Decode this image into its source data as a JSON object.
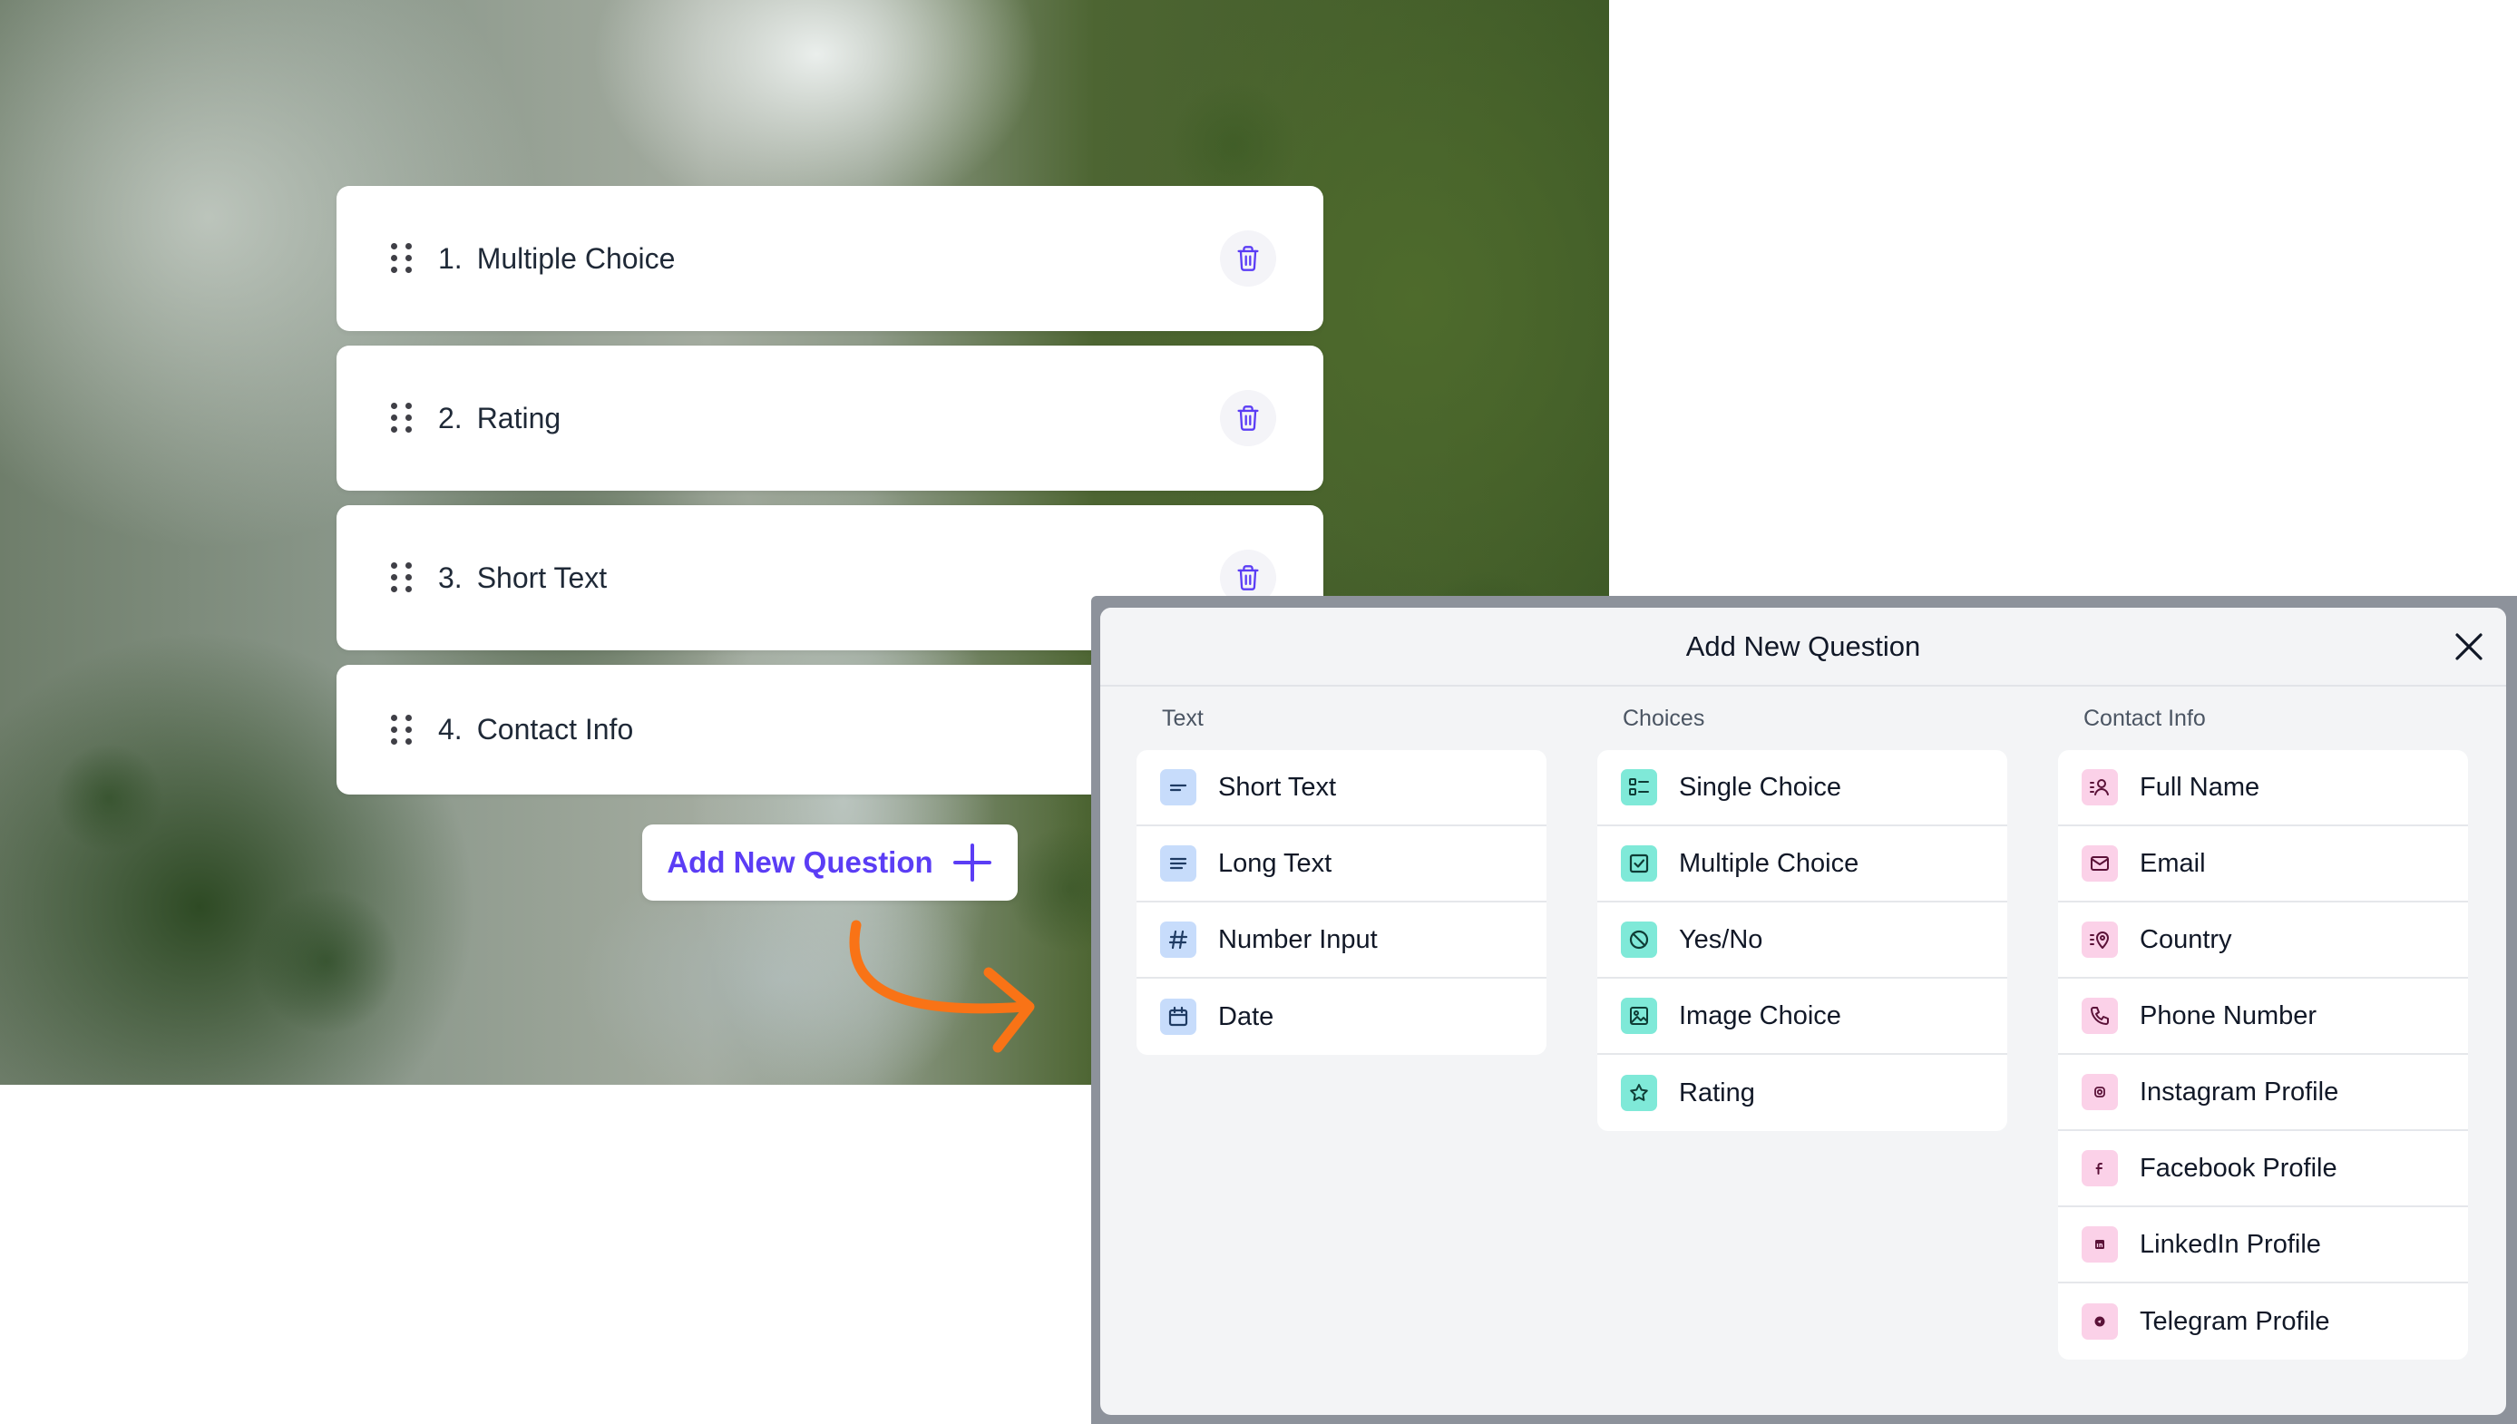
{
  "questions": [
    {
      "number": "1.",
      "title": "Multiple Choice"
    },
    {
      "number": "2.",
      "title": "Rating"
    },
    {
      "number": "3.",
      "title": "Short Text"
    },
    {
      "number": "4.",
      "title": "Contact Info"
    }
  ],
  "add_button": {
    "label": "Add New Question"
  },
  "colors": {
    "accent": "#5b3df5",
    "arrow": "#f97316",
    "text_icon_bg": "#c7dcfb",
    "choice_icon_bg": "#7fe9d8",
    "contact_icon_bg": "#fbd1e8"
  },
  "modal": {
    "title": "Add New Question",
    "columns": [
      {
        "heading": "Text",
        "items": [
          {
            "label": "Short Text",
            "icon": "short-text-icon"
          },
          {
            "label": "Long Text",
            "icon": "long-text-icon"
          },
          {
            "label": "Number Input",
            "icon": "hash-icon"
          },
          {
            "label": "Date",
            "icon": "calendar-icon"
          }
        ]
      },
      {
        "heading": "Choices",
        "items": [
          {
            "label": "Single Choice",
            "icon": "single-choice-icon"
          },
          {
            "label": "Multiple Choice",
            "icon": "checkbox-icon"
          },
          {
            "label": "Yes/No",
            "icon": "yes-no-icon"
          },
          {
            "label": "Image Choice",
            "icon": "image-icon"
          },
          {
            "label": "Rating",
            "icon": "star-icon"
          }
        ]
      },
      {
        "heading": "Contact Info",
        "items": [
          {
            "label": "Full Name",
            "icon": "user-icon"
          },
          {
            "label": "Email",
            "icon": "mail-icon"
          },
          {
            "label": "Country",
            "icon": "location-pin-icon"
          },
          {
            "label": "Phone Number",
            "icon": "phone-icon"
          },
          {
            "label": "Instagram Profile",
            "icon": "instagram-icon"
          },
          {
            "label": "Facebook Profile",
            "icon": "facebook-icon"
          },
          {
            "label": "LinkedIn Profile",
            "icon": "linkedin-icon"
          },
          {
            "label": "Telegram Profile",
            "icon": "telegram-icon"
          }
        ]
      }
    ]
  }
}
